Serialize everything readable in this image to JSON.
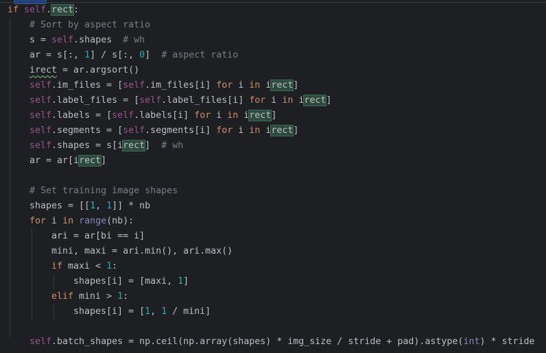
{
  "editor": {
    "lines": [
      {
        "indent": 0,
        "tokens": [
          {
            "t": "if ",
            "c": "kw"
          },
          {
            "t": "self",
            "c": "self"
          },
          {
            "t": ".",
            "c": "plain"
          },
          {
            "t": "rect",
            "c": "hl"
          },
          {
            "t": ":",
            "c": "plain"
          }
        ]
      },
      {
        "indent": 1,
        "tokens": [
          {
            "t": "# Sort by aspect ratio",
            "c": "cm"
          }
        ]
      },
      {
        "indent": 1,
        "tokens": [
          {
            "t": "s = ",
            "c": "plain"
          },
          {
            "t": "self",
            "c": "self"
          },
          {
            "t": ".shapes  ",
            "c": "plain"
          },
          {
            "t": "# wh",
            "c": "cm"
          }
        ]
      },
      {
        "indent": 1,
        "tokens": [
          {
            "t": "ar = s[:, ",
            "c": "plain"
          },
          {
            "t": "1",
            "c": "num"
          },
          {
            "t": "] / s[:, ",
            "c": "plain"
          },
          {
            "t": "0",
            "c": "num"
          },
          {
            "t": "]  ",
            "c": "plain"
          },
          {
            "t": "# aspect ratio",
            "c": "cm"
          }
        ]
      },
      {
        "indent": 1,
        "tokens": [
          {
            "t": "irect",
            "c": "wavy"
          },
          {
            "t": " = ar.argsort()",
            "c": "plain"
          }
        ]
      },
      {
        "indent": 1,
        "tokens": [
          {
            "t": "self",
            "c": "self"
          },
          {
            "t": ".im_files = [",
            "c": "plain"
          },
          {
            "t": "self",
            "c": "self"
          },
          {
            "t": ".im_files[i] ",
            "c": "plain"
          },
          {
            "t": "for",
            "c": "kw"
          },
          {
            "t": " i ",
            "c": "plain"
          },
          {
            "t": "in",
            "c": "kw"
          },
          {
            "t": " i",
            "c": "plain"
          },
          {
            "t": "rect",
            "c": "hl"
          },
          {
            "t": "]",
            "c": "plain"
          }
        ]
      },
      {
        "indent": 1,
        "tokens": [
          {
            "t": "self",
            "c": "self"
          },
          {
            "t": ".label_files = [",
            "c": "plain"
          },
          {
            "t": "self",
            "c": "self"
          },
          {
            "t": ".label_files[i] ",
            "c": "plain"
          },
          {
            "t": "for",
            "c": "kw"
          },
          {
            "t": " i ",
            "c": "plain"
          },
          {
            "t": "in",
            "c": "kw"
          },
          {
            "t": " i",
            "c": "plain"
          },
          {
            "t": "rect",
            "c": "hl"
          },
          {
            "t": "]",
            "c": "plain"
          }
        ]
      },
      {
        "indent": 1,
        "tokens": [
          {
            "t": "self",
            "c": "self"
          },
          {
            "t": ".labels = [",
            "c": "plain"
          },
          {
            "t": "self",
            "c": "self"
          },
          {
            "t": ".labels[i] ",
            "c": "plain"
          },
          {
            "t": "for",
            "c": "kw"
          },
          {
            "t": " i ",
            "c": "plain"
          },
          {
            "t": "in",
            "c": "kw"
          },
          {
            "t": " i",
            "c": "plain"
          },
          {
            "t": "rect",
            "c": "hl"
          },
          {
            "t": "]",
            "c": "plain"
          }
        ]
      },
      {
        "indent": 1,
        "tokens": [
          {
            "t": "self",
            "c": "self"
          },
          {
            "t": ".segments = [",
            "c": "plain"
          },
          {
            "t": "self",
            "c": "self"
          },
          {
            "t": ".segments[i] ",
            "c": "plain"
          },
          {
            "t": "for",
            "c": "kw"
          },
          {
            "t": " i ",
            "c": "plain"
          },
          {
            "t": "in",
            "c": "kw"
          },
          {
            "t": " i",
            "c": "plain"
          },
          {
            "t": "rect",
            "c": "hl"
          },
          {
            "t": "]",
            "c": "plain"
          }
        ]
      },
      {
        "indent": 1,
        "tokens": [
          {
            "t": "self",
            "c": "self"
          },
          {
            "t": ".shapes = s[i",
            "c": "plain"
          },
          {
            "t": "rect",
            "c": "hl"
          },
          {
            "t": "]  ",
            "c": "plain"
          },
          {
            "t": "# wh",
            "c": "cm"
          }
        ]
      },
      {
        "indent": 1,
        "tokens": [
          {
            "t": "ar = ar[i",
            "c": "plain"
          },
          {
            "t": "rect",
            "c": "hl"
          },
          {
            "t": "]",
            "c": "plain"
          }
        ]
      },
      {
        "indent": 0,
        "tokens": []
      },
      {
        "indent": 1,
        "tokens": [
          {
            "t": "# Set training image shapes",
            "c": "cm"
          }
        ]
      },
      {
        "indent": 1,
        "tokens": [
          {
            "t": "shapes = [[",
            "c": "plain"
          },
          {
            "t": "1",
            "c": "num"
          },
          {
            "t": ", ",
            "c": "plain"
          },
          {
            "t": "1",
            "c": "num"
          },
          {
            "t": "]] * nb",
            "c": "plain"
          }
        ]
      },
      {
        "indent": 1,
        "tokens": [
          {
            "t": "for",
            "c": "kw"
          },
          {
            "t": " i ",
            "c": "plain"
          },
          {
            "t": "in",
            "c": "kw"
          },
          {
            "t": " ",
            "c": "plain"
          },
          {
            "t": "range",
            "c": "builtin"
          },
          {
            "t": "(nb):",
            "c": "plain"
          }
        ]
      },
      {
        "indent": 2,
        "tokens": [
          {
            "t": "ari = ar[bi == i]",
            "c": "plain"
          }
        ]
      },
      {
        "indent": 2,
        "tokens": [
          {
            "t": "mini, maxi = ari.min(), ari.max()",
            "c": "plain"
          }
        ]
      },
      {
        "indent": 2,
        "tokens": [
          {
            "t": "if",
            "c": "kw"
          },
          {
            "t": " maxi < ",
            "c": "plain"
          },
          {
            "t": "1",
            "c": "num"
          },
          {
            "t": ":",
            "c": "plain"
          }
        ]
      },
      {
        "indent": 3,
        "tokens": [
          {
            "t": "shapes[i] = [maxi, ",
            "c": "plain"
          },
          {
            "t": "1",
            "c": "num"
          },
          {
            "t": "]",
            "c": "plain"
          }
        ]
      },
      {
        "indent": 2,
        "tokens": [
          {
            "t": "elif",
            "c": "kw"
          },
          {
            "t": " mini > ",
            "c": "plain"
          },
          {
            "t": "1",
            "c": "num"
          },
          {
            "t": ":",
            "c": "plain"
          }
        ]
      },
      {
        "indent": 3,
        "tokens": [
          {
            "t": "shapes[i] = [",
            "c": "plain"
          },
          {
            "t": "1",
            "c": "num"
          },
          {
            "t": ", ",
            "c": "plain"
          },
          {
            "t": "1",
            "c": "num"
          },
          {
            "t": " / mini]",
            "c": "plain"
          }
        ]
      },
      {
        "indent": 0,
        "tokens": []
      },
      {
        "indent": 1,
        "tokens": [
          {
            "t": "self",
            "c": "self"
          },
          {
            "t": ".batch_shapes = np.ceil(np.array(shapes) * img_size / stride + pad).astype(",
            "c": "plain"
          },
          {
            "t": "int",
            "c": "builtin"
          },
          {
            "t": ") * stride",
            "c": "plain"
          }
        ]
      }
    ]
  },
  "colors": {
    "background": "#1e1f22",
    "keyword": "#cf8e6d",
    "self": "#94558d",
    "number": "#2aacb8",
    "comment": "#7a7e85",
    "text": "#bcbec4",
    "highlight": "#2c4a3d"
  }
}
